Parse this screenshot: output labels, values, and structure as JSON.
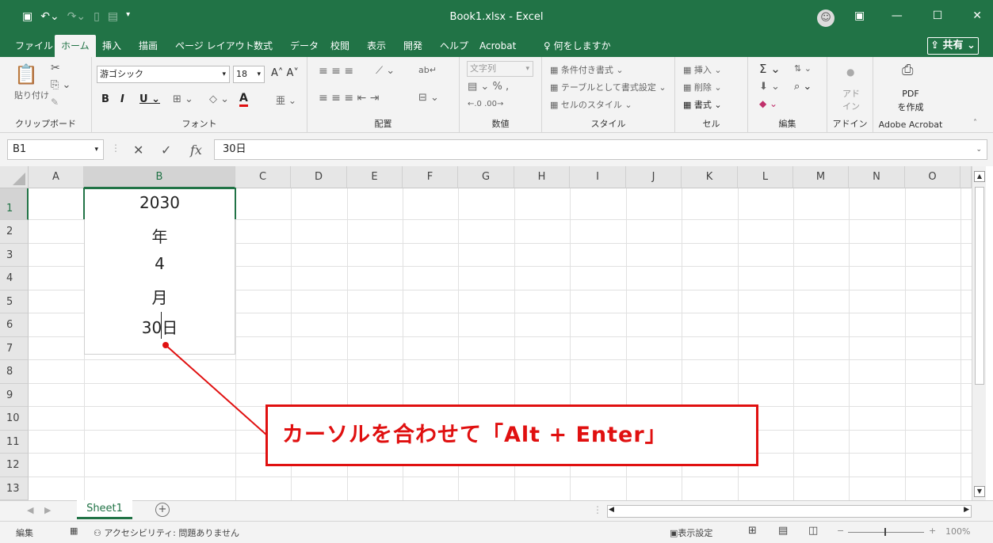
{
  "titlebar": {
    "title": "Book1.xlsx  -  Excel",
    "qat": [
      "save-icon",
      "undo-icon",
      "redo-icon",
      "new-file-icon",
      "form-icon",
      "customize-icon"
    ],
    "controls": [
      "ribbon-display-icon",
      "minimize-icon",
      "maximize-icon",
      "close-icon"
    ]
  },
  "menu": {
    "tabs": [
      "ファイル",
      "ホーム",
      "挿入",
      "描画",
      "ページ レイアウト",
      "数式",
      "データ",
      "校閲",
      "表示",
      "開発",
      "ヘルプ",
      "Acrobat",
      "何をしますか"
    ],
    "share": "共有"
  },
  "ribbon": {
    "clipboard": {
      "label": "クリップボード",
      "paste": "貼り付け"
    },
    "font": {
      "label": "フォント",
      "name": "游ゴシック",
      "size": "18"
    },
    "alignment": {
      "label": "配置"
    },
    "number": {
      "label": "数値",
      "format": "文字列",
      "percent": "%"
    },
    "style": {
      "label": "スタイル",
      "cond": "条件付き書式",
      "table": "テーブルとして書式設定",
      "cellstyle": "セルのスタイル"
    },
    "cells": {
      "label": "セル",
      "insert": "挿入",
      "delete": "削除",
      "format": "書式"
    },
    "editing": {
      "label": "編集"
    },
    "addin": {
      "label": "アドイン",
      "btn": "アド イン"
    },
    "acrobat": {
      "label": "Adobe Acrobat",
      "btn1": "PDF",
      "btn2": "を作成"
    }
  },
  "formula": {
    "namebox": "B1",
    "value": "30日"
  },
  "columns": [
    "A",
    "B",
    "C",
    "D",
    "E",
    "F",
    "G",
    "H",
    "I",
    "J",
    "K",
    "L",
    "M",
    "N",
    "O"
  ],
  "rows": [
    "1",
    "2",
    "3",
    "4",
    "5",
    "6",
    "7",
    "8",
    "9",
    "10",
    "11",
    "12",
    "13"
  ],
  "cell_b1_lines": [
    "2030",
    "年",
    "4",
    "月",
    "30日"
  ],
  "callout": "カーソルを合わせて「Alt + Enter」",
  "sheet": {
    "name": "Sheet1",
    "add": "+"
  },
  "status": {
    "mode": "編集",
    "accessibility": "アクセシビリティ: 問題ありません",
    "display_settings": "表示設定",
    "zoom": "100%"
  },
  "colors": {
    "excel_green": "#217346",
    "callout_red": "#e01010"
  }
}
